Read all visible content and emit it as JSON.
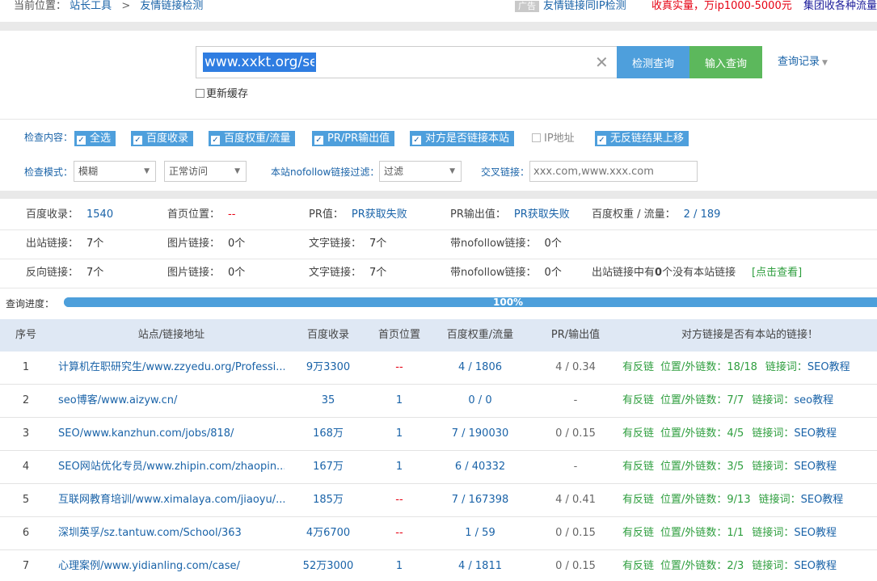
{
  "breadcrumb": {
    "prefix": "当前位置：",
    "level1": "站长工具",
    "separator": ">",
    "level2": "友情链接检测"
  },
  "ads": {
    "badge": "广告",
    "link1": "友情链接同IP检测",
    "link2": "收真实量，万ip1000-5000元",
    "link3": "集团收各种流量"
  },
  "search": {
    "value": "www.xxkt.org/seo",
    "detect_button": "检测查询",
    "input_button": "输入查询",
    "history": "查询记录",
    "refresh_cache": "更新缓存"
  },
  "options": {
    "check_label": "检查内容：",
    "checks": [
      {
        "label": "全选",
        "checked": true
      },
      {
        "label": "百度收录",
        "checked": true
      },
      {
        "label": "百度权重/流量",
        "checked": true
      },
      {
        "label": "PR/PR输出值",
        "checked": true
      },
      {
        "label": "对方是否链接本站",
        "checked": true
      },
      {
        "label": "IP地址",
        "checked": false
      },
      {
        "label": "无反链结果上移",
        "checked": true
      }
    ],
    "mode_label": "检查模式：",
    "mode_value": "模糊",
    "access_value": "正常访问",
    "nofollow_label": "本站nofollow链接过滤：",
    "nofollow_value": "过滤",
    "cross_label": "交叉链接：",
    "cross_placeholder": "xxx.com,www.xxx.com"
  },
  "stats": {
    "baidu_index_label": "百度收录：",
    "baidu_index": "1540",
    "home_pos_label": "首页位置：",
    "home_pos": "--",
    "pr_label": "PR值：",
    "pr": "PR获取失败",
    "pr_out_label": "PR输出值：",
    "pr_out": "PR获取失败",
    "weight_label": "百度权重 / 流量：",
    "weight": "2 / 189",
    "out_links_label": "出站链接：",
    "out_links": "7个",
    "img_links_label": "图片链接：",
    "img_links": "0个",
    "text_links_label": "文字链接：",
    "text_links": "7个",
    "nofollow_links_label": "带nofollow链接：",
    "nofollow_links": "0个",
    "back_links_label": "反向链接：",
    "back_links": "7个",
    "img_links2": "0个",
    "text_links2": "7个",
    "nofollow_links2": "0个",
    "summary_prefix": "出站链接中有",
    "summary_count": "0",
    "summary_suffix": "个没有本站链接",
    "view_link": "[点击查看]"
  },
  "progress": {
    "label": "查询进度：",
    "value": 100,
    "text": "100%"
  },
  "table": {
    "headers": [
      "序号",
      "站点/链接地址",
      "百度收录",
      "首页位置",
      "百度权重/流量",
      "PR/输出值",
      "对方链接是否有本站的链接！"
    ],
    "rows": [
      {
        "n": "1",
        "site": "计算机在职研究生/www.zzyedu.org/Professi...",
        "bd": "9万3300",
        "pos": "--",
        "w": "4 / 1806",
        "pr": "4 / 0.34",
        "has": "有反链",
        "loc": "位置/外链数：18/18",
        "kw_label": "链接词：",
        "kw": "SEO教程"
      },
      {
        "n": "2",
        "site": "seo博客/www.aizyw.cn/",
        "bd": "35",
        "pos": "1",
        "w": "0 / 0",
        "pr": "-",
        "has": "有反链",
        "loc": "位置/外链数：7/7",
        "kw_label": "链接词：",
        "kw": "seo教程"
      },
      {
        "n": "3",
        "site": "SEO/www.kanzhun.com/jobs/818/",
        "bd": "168万",
        "pos": "1",
        "w": "7 / 190030",
        "pr": "0 / 0.15",
        "has": "有反链",
        "loc": "位置/外链数：4/5",
        "kw_label": "链接词：",
        "kw": "SEO教程"
      },
      {
        "n": "4",
        "site": "SEO网站优化专员/www.zhipin.com/zhaopin...",
        "bd": "167万",
        "pos": "1",
        "w": "6 / 40332",
        "pr": "-",
        "has": "有反链",
        "loc": "位置/外链数：3/5",
        "kw_label": "链接词：",
        "kw": "SEO教程"
      },
      {
        "n": "5",
        "site": "互联网教育培训/www.ximalaya.com/jiaoyu/...",
        "bd": "185万",
        "pos": "--",
        "w": "7 / 167398",
        "pr": "4 / 0.41",
        "has": "有反链",
        "loc": "位置/外链数：9/13",
        "kw_label": "链接词：",
        "kw": "SEO教程"
      },
      {
        "n": "6",
        "site": "深圳英孚/sz.tantuw.com/School/363",
        "bd": "4万6700",
        "pos": "--",
        "w": "1 / 59",
        "pr": "0 / 0.15",
        "has": "有反链",
        "loc": "位置/外链数：1/1",
        "kw_label": "链接词：",
        "kw": "SEO教程"
      },
      {
        "n": "7",
        "site": "心理案例/www.yidianling.com/case/",
        "bd": "52万3000",
        "pos": "1",
        "w": "4 / 1811",
        "pr": "0 / 0.15",
        "has": "有反链",
        "loc": "位置/外链数：2/3",
        "kw_label": "链接词：",
        "kw": "SEO教程"
      }
    ]
  },
  "colors": {
    "link": "#1a63a8",
    "accent_blue": "#4e9fdc",
    "accent_green": "#5cb85c",
    "warn_red": "#e60012",
    "ok_green": "#2e9e3e"
  }
}
